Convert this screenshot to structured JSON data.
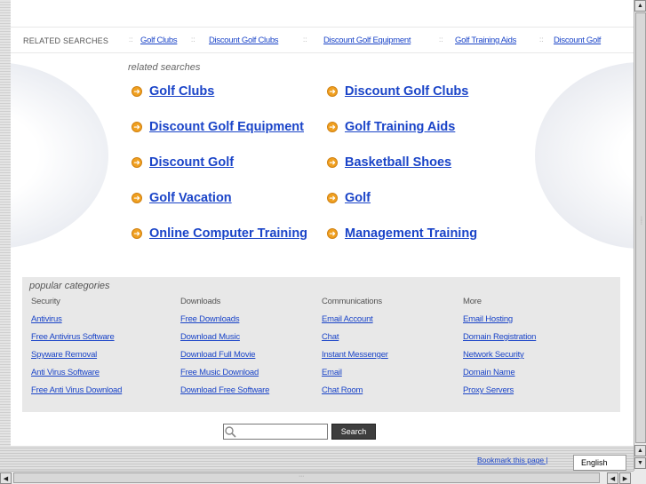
{
  "related_bar": {
    "title": "RELATED SEARCHES",
    "links": [
      "Golf Clubs",
      "Discount Golf Clubs",
      "Discount Golf Equipment",
      "Golf Training Aids",
      "Discount Golf"
    ],
    "separator": "::"
  },
  "related": {
    "heading": "related searches",
    "items": [
      "Golf Clubs",
      "Discount Golf Clubs",
      "Discount Golf Equipment",
      "Golf Training Aids",
      "Discount Golf",
      "Basketball Shoes",
      "Golf Vacation",
      "Golf",
      "Online Computer Training",
      "Management Training"
    ],
    "arrow_glyph": "➜"
  },
  "popular": {
    "title": "popular categories",
    "columns": [
      {
        "head": "Security",
        "links": [
          "Antivirus",
          "Free Antivirus Software",
          "Spyware Removal",
          "Anti Virus Software",
          "Free Anti Virus Download"
        ]
      },
      {
        "head": "Downloads",
        "links": [
          "Free Downloads",
          "Download Music",
          "Download Full Movie",
          "Free Music Download",
          "Download Free Software"
        ]
      },
      {
        "head": "Communications",
        "links": [
          "Email Account",
          "Chat",
          "Instant Messenger",
          "Email",
          "Chat Room"
        ]
      },
      {
        "head": "More",
        "links": [
          "Email Hosting",
          "Domain Registration",
          "Network Security",
          "Domain Name",
          "Proxy Servers"
        ]
      }
    ]
  },
  "search": {
    "value": "",
    "button_label": "Search",
    "icon": "magnifier-icon"
  },
  "footer": {
    "bookmark": "Bookmark this page |",
    "language": "English"
  },
  "colors": {
    "link": "#1a44c8",
    "arrow": "#f0a020",
    "panel": "#e8e8e8",
    "button": "#3e3e3e"
  }
}
